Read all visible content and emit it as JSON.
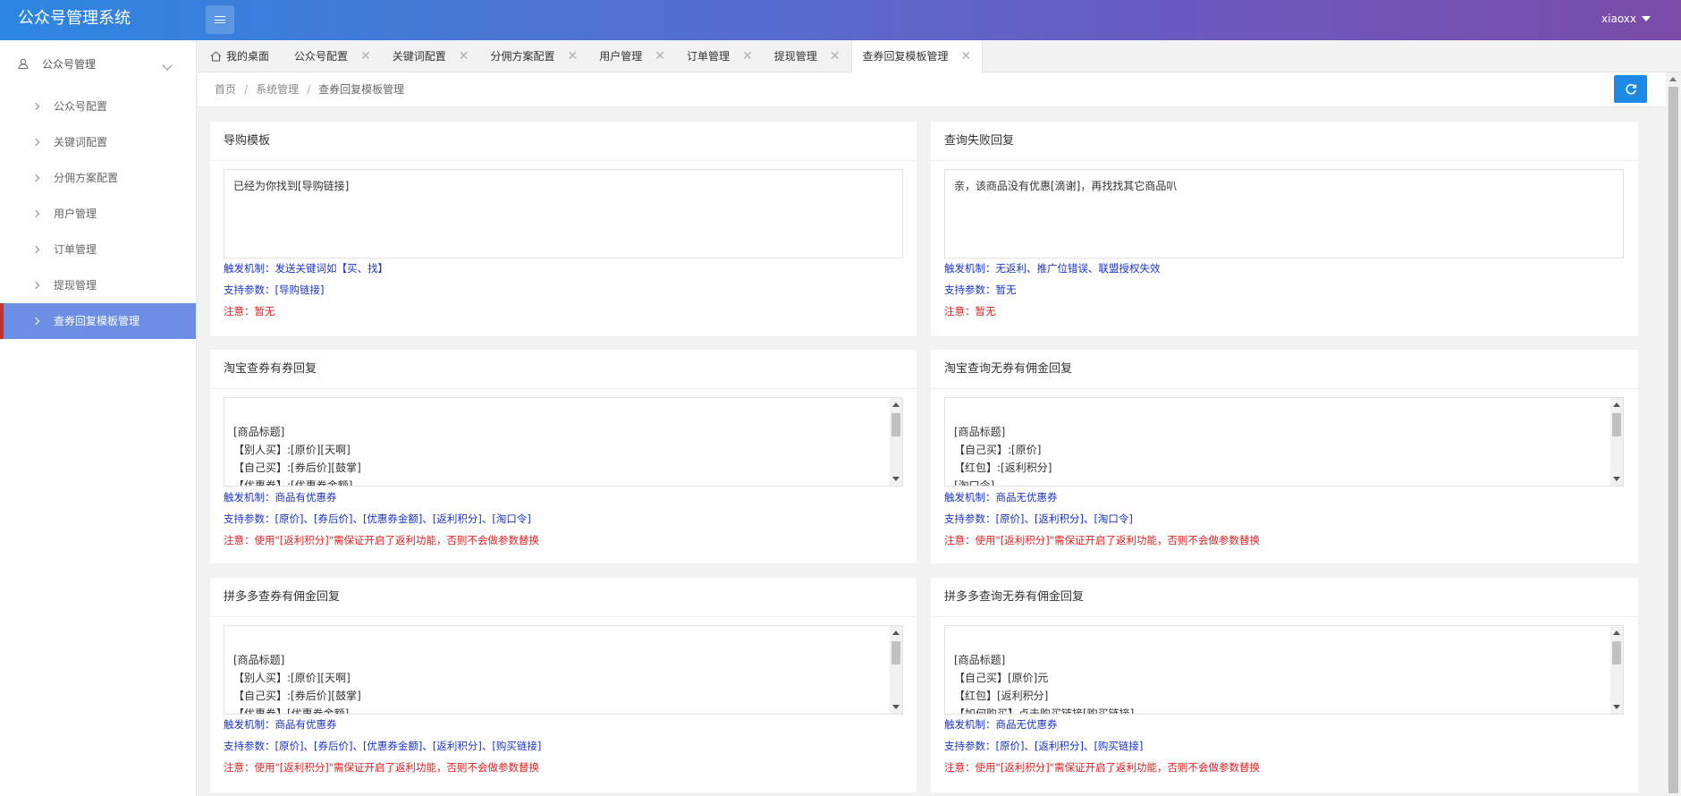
{
  "header": {
    "title": "公众号管理系统",
    "user": "xiaoxx"
  },
  "sidebar": {
    "group_label": "公众号管理",
    "items": [
      {
        "label": "公众号配置"
      },
      {
        "label": "关键词配置"
      },
      {
        "label": "分佣方案配置"
      },
      {
        "label": "用户管理"
      },
      {
        "label": "订单管理"
      },
      {
        "label": "提现管理"
      },
      {
        "label": "查券回复模板管理"
      }
    ]
  },
  "tabs": [
    {
      "label": "我的桌面"
    },
    {
      "label": "公众号配置"
    },
    {
      "label": "关键词配置"
    },
    {
      "label": "分佣方案配置"
    },
    {
      "label": "用户管理"
    },
    {
      "label": "订单管理"
    },
    {
      "label": "提现管理"
    },
    {
      "label": "查券回复模板管理"
    }
  ],
  "close_glyph": "✕",
  "breadcrumb": {
    "items": [
      "首页",
      "系统管理",
      "查券回复模板管理"
    ],
    "separator": "/"
  },
  "cards": [
    {
      "title": "导购模板",
      "content": "已经为你找到[导购链接]",
      "trigger": "触发机制：发送关键词如【买、找】",
      "params": "支持参数：[导购链接]",
      "note": "注意：暂无"
    },
    {
      "title": "查询失败回复",
      "content": "亲，该商品没有优惠[滴谢]，再找找其它商品叭",
      "trigger": "触发机制：无返利、推广位错误、联盟授权失效",
      "params": "支持参数：暂无",
      "note": "注意：暂无"
    },
    {
      "title": "淘宝查券有券回复",
      "content": "[商品标题]\n【别人买】:[原价][天啊]\n【自己买】:[券后价][鼓掌]\n【优惠券】:[优惠券金额]\n【红包】:[返利积分]",
      "trigger": "触发机制：商品有优惠券",
      "params": "支持参数：[原价]、[券后价]、[优惠券金额]、[返利积分]、[淘口令]",
      "note": "注意：使用\"[返利积分]\"需保证开启了返利功能，否则不会做参数替换"
    },
    {
      "title": "淘宝查询无券有佣金回复",
      "content": "[商品标题]\n【自己买】:[原价]\n【红包】:[返利积分]\n[淘口令]\n□【返利方法】:",
      "trigger": "触发机制：商品无优惠券",
      "params": "支持参数：[原价]、[返利积分]、[淘口令]",
      "note": "注意：使用\"[返利积分]\"需保证开启了返利功能，否则不会做参数替换"
    },
    {
      "title": "拼多多查券有佣金回复",
      "content": "[商品标题]\n【别人买】:[原价][天啊]\n【自己买】:[券后价][鼓掌]\n【优惠券】[优惠券金额]\n【红包】:[返利积分]",
      "trigger": "触发机制：商品有优惠券",
      "params": "支持参数：[原价]、[券后价]、[优惠券金额]、[返利积分]、[购买链接]",
      "note": "注意：使用\"[返利积分]\"需保证开启了返利功能，否则不会做参数替换"
    },
    {
      "title": "拼多多查询无券有佣金回复",
      "content": "[商品标题]\n【自己买】[原价]元\n【红包】[返利积分]\n【如何购买】点击购买链接[购买链接]\n——————",
      "trigger": "触发机制：商品无优惠券",
      "params": "支持参数：[原价]、[返利积分]、[购买链接]",
      "note": "注意：使用\"[返利积分]\"需保证开启了返利功能，否则不会做参数替换"
    }
  ],
  "colors": {
    "accent": "#1e88e5",
    "sidebar_active": "#6d8fe3",
    "sidebar_active_marker": "#c7312f",
    "info_text": "#1a33c8",
    "warning_text": "#e02020"
  }
}
